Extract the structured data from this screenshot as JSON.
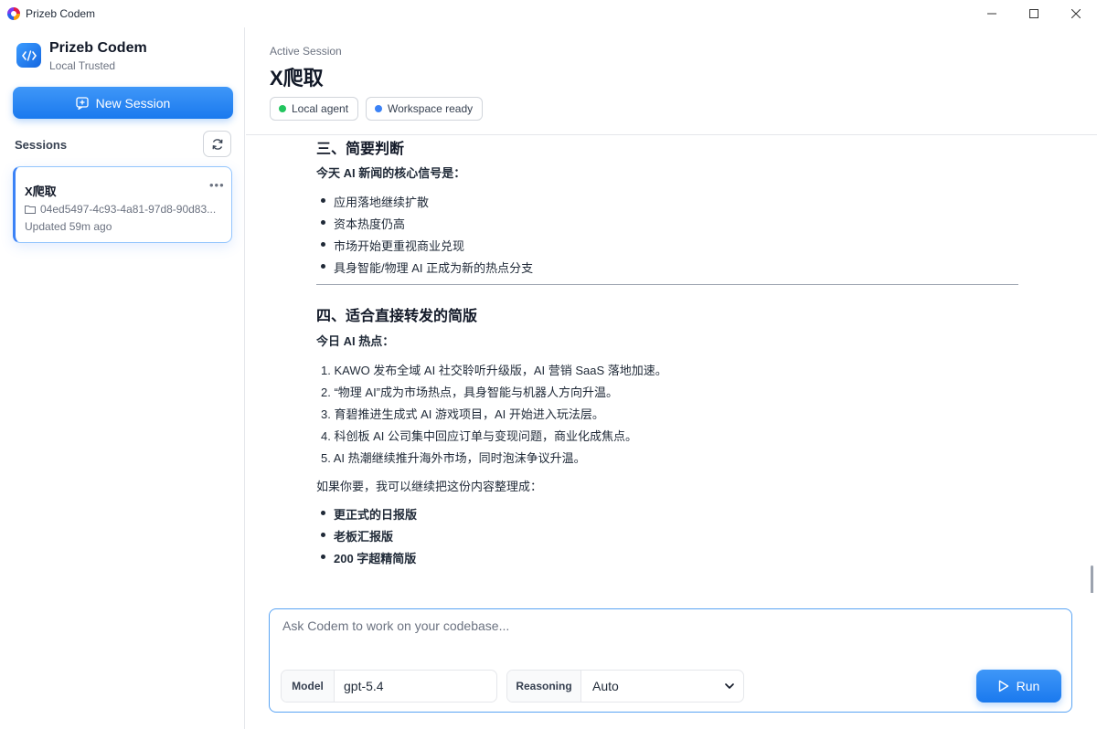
{
  "window": {
    "title": "Prizeb Codem",
    "icon": "app-logo-icon"
  },
  "sidebar": {
    "brand_name": "Prizeb Codem",
    "brand_sub": "Local Trusted",
    "new_session_label": "New Session",
    "sessions_label": "Sessions",
    "sessions": [
      {
        "title": "X爬取",
        "path": "04ed5497-4c93-4a81-97d8-90d83...",
        "updated": "Updated 59m ago"
      }
    ]
  },
  "header": {
    "active_label": "Active Session",
    "title": "X爬取",
    "chips": [
      {
        "label": "Local agent",
        "color": "#22c55e"
      },
      {
        "label": "Workspace ready",
        "color": "#3b82f6"
      }
    ]
  },
  "content": {
    "section3_title": "三、简要判断",
    "section3_lead": "今天 AI 新闻的核心信号是：",
    "section3_items": [
      "应用落地继续扩散",
      "资本热度仍高",
      "市场开始更重视商业兑现",
      "具身智能/物理 AI 正成为新的热点分支"
    ],
    "section4_title": "四、适合直接转发的简版",
    "section4_lead": "今日 AI 热点：",
    "section4_items": [
      "1. KAWO 发布全域 AI 社交聆听升级版，AI 营销 SaaS 落地加速。",
      "2. “物理 AI”成为市场热点，具身智能与机器人方向升温。",
      "3. 育碧推进生成式 AI 游戏项目，AI 开始进入玩法层。",
      "4. 科创板 AI 公司集中回应订单与变现问题，商业化成焦点。",
      "5. AI 热潮继续推升海外市场，同时泡沫争议升温。"
    ],
    "followup": "如果你要，我可以继续把这份内容整理成：",
    "followup_items": [
      "更正式的日报版",
      "老板汇报版",
      "200 字超精简版"
    ]
  },
  "composer": {
    "placeholder": "Ask Codem to work on your codebase...",
    "model_label": "Model",
    "model_value": "gpt-5.4",
    "reasoning_label": "Reasoning",
    "reasoning_value": "Auto",
    "run_label": "Run"
  },
  "colors": {
    "accent": "#1a79ee",
    "status_ok": "#22c55e",
    "status_info": "#3b82f6"
  }
}
